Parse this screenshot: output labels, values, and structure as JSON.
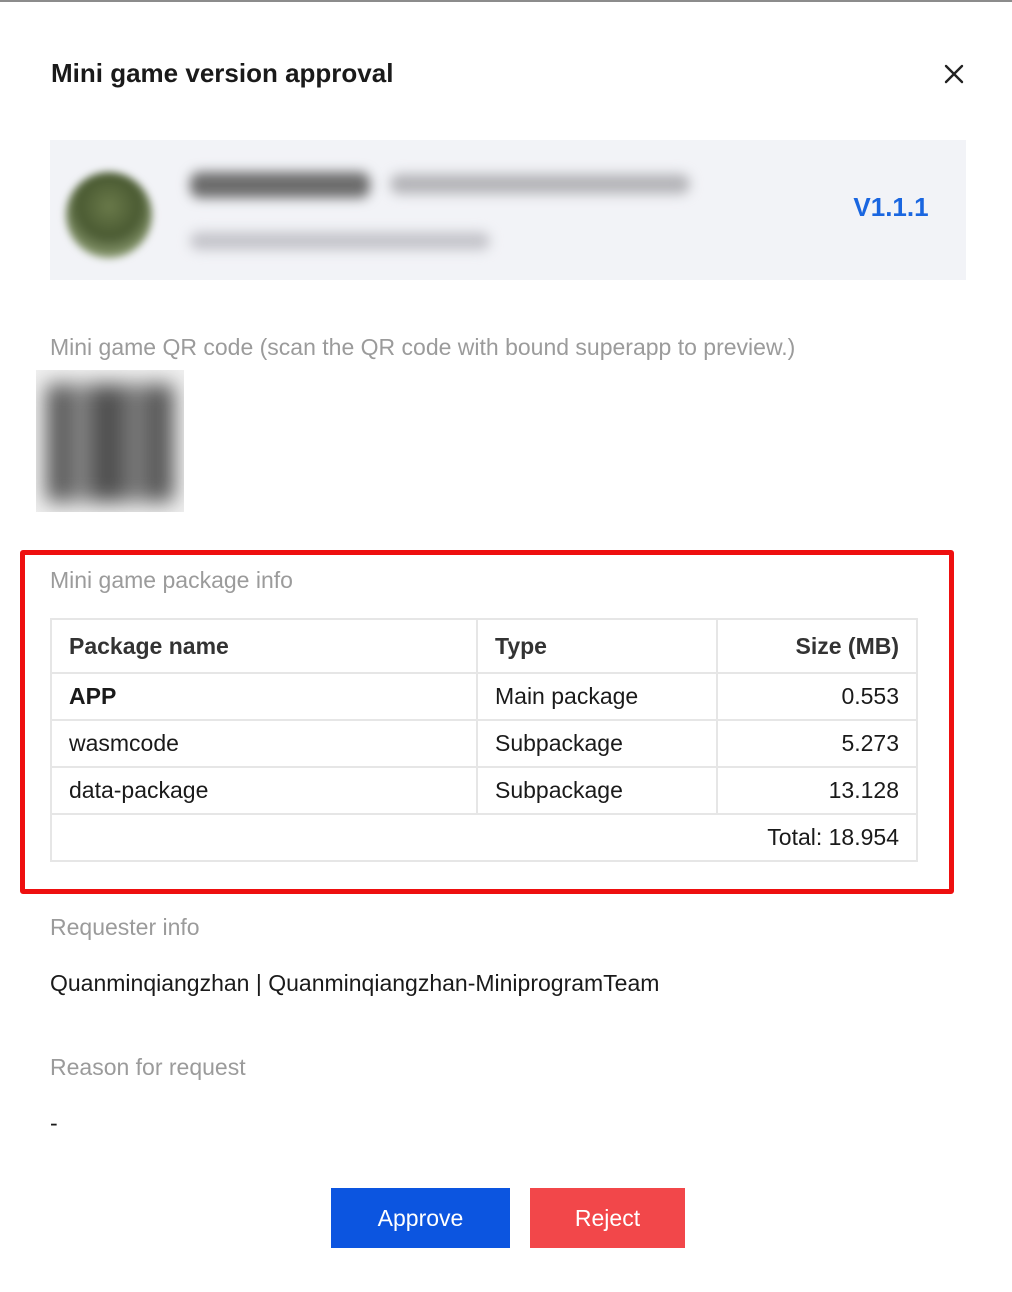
{
  "dialog": {
    "title": "Mini game version approval",
    "close_icon": "close-icon"
  },
  "app_card": {
    "version": "V1.1.1",
    "accent_color": "#1a66e0"
  },
  "qr_section": {
    "label": "Mini game QR code (scan the QR code with bound superapp to preview.)"
  },
  "package_section": {
    "label": "Mini game package info",
    "headers": {
      "name": "Package name",
      "type": "Type",
      "size": "Size (MB)"
    },
    "rows": [
      {
        "name": "APP",
        "type": "Main package",
        "size": "0.553"
      },
      {
        "name": "wasmcode",
        "type": "Subpackage",
        "size": "5.273"
      },
      {
        "name": "data-package",
        "type": "Subpackage",
        "size": "13.128"
      }
    ],
    "total": "Total: 18.954",
    "highlight_color": "#ee0f0f"
  },
  "requester_section": {
    "label": "Requester info",
    "value": "Quanminqiangzhan | Quanminqiangzhan-MiniprogramTeam"
  },
  "reason_section": {
    "label": "Reason for request",
    "value": "-"
  },
  "actions": {
    "approve_label": "Approve",
    "reject_label": "Reject",
    "approve_color": "#0c55e0",
    "reject_color": "#f2474a"
  }
}
